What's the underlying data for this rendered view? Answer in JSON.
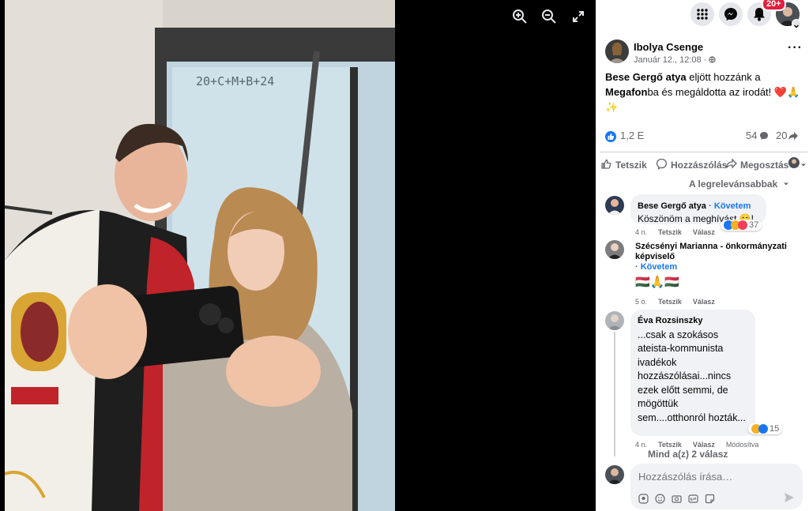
{
  "viewer": {
    "controls": [
      "zoom-in-icon",
      "zoom-out-icon",
      "fullscreen-icon"
    ],
    "photo_board_text": "20+C+M+B+24"
  },
  "topbar": {
    "notifications_badge": "20+",
    "buttons": [
      "menu-grid-icon",
      "messenger-icon",
      "bell-icon",
      "profile-avatar"
    ]
  },
  "post": {
    "author": "Ibolya Csenge",
    "date": "Január 12., 12:08 ·",
    "text_part1_bold": "Bese Gergő atya",
    "text_part2": " eljött hozzánk a ",
    "text_part3_bold": "Megafon",
    "text_part4": "ba és megáldotta az irodát! ",
    "text_emoji": "❤️🙏",
    "text_emoji2": "✨",
    "reactions_count": "1,2 E",
    "comments_count": "54",
    "shares_count": "20"
  },
  "actions": {
    "like": "Tetszik",
    "comment": "Hozzászólás",
    "share": "Megosztás"
  },
  "comments_sort": "A legrelevánsabbak",
  "comments": [
    {
      "name": "Bese Gergő atya",
      "follow": "· Követem",
      "text": "Köszönöm a meghívást 😊!",
      "time": "4 n.",
      "like": "Tetszik",
      "reply": "Válasz",
      "reactions": "37"
    },
    {
      "name": "Szécsényi Marianna - önkormányzati képviselő",
      "follow": "· Követem",
      "text": "🇭🇺🙏🇭🇺",
      "time": "5 ó.",
      "like": "Tetszik",
      "reply": "Válasz"
    },
    {
      "name": "Éva Rozsinszky",
      "text": "...csak a szokásos ateista-kommunista ivadékok hozzászólásai...nincs ezek előtt semmi, de mögöttük sem....otthonról hozták...",
      "time": "4 n.",
      "like": "Tetszik",
      "reply": "Válasz",
      "edited": "Módosítva",
      "reactions": "15",
      "more_replies": "Mind a(z) 2 válasz"
    }
  ],
  "composer": {
    "placeholder": "Hozzászólás írása…"
  },
  "colors": {
    "accent": "#1877f2",
    "text": "#050505",
    "secondary": "#65676b",
    "badge": "#e41e3f"
  }
}
